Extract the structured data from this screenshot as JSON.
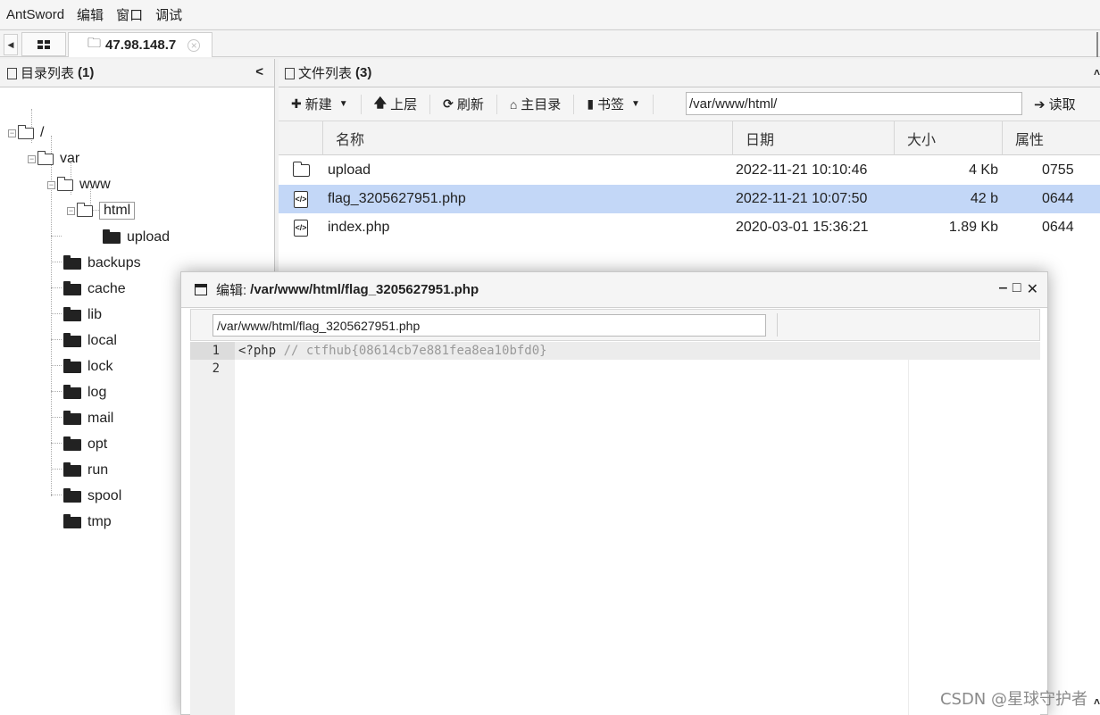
{
  "menubar": {
    "items": [
      "AntSword",
      "编辑",
      "窗口",
      "调试"
    ]
  },
  "tabs": {
    "host_label": "47.98.148.7"
  },
  "dir_panel": {
    "title": "目录列表",
    "count": "(1)",
    "tree": [
      {
        "label": "/"
      },
      {
        "label": "var"
      },
      {
        "label": "www"
      },
      {
        "label": "html"
      },
      {
        "label": "upload"
      },
      {
        "label": "backups"
      },
      {
        "label": "cache"
      },
      {
        "label": "lib"
      },
      {
        "label": "local"
      },
      {
        "label": "lock"
      },
      {
        "label": "log"
      },
      {
        "label": "mail"
      },
      {
        "label": "opt"
      },
      {
        "label": "run"
      },
      {
        "label": "spool"
      },
      {
        "label": "tmp"
      }
    ]
  },
  "file_panel": {
    "title": "文件列表",
    "count": "(3)",
    "toolbar": {
      "new_label": "新建",
      "up_label": "上层",
      "refresh_label": "刷新",
      "home_label": "主目录",
      "bookmark_label": "书签",
      "path_value": "/var/www/html/",
      "read_label": "读取"
    },
    "columns": [
      "名称",
      "日期",
      "大小",
      "属性"
    ],
    "rows": [
      {
        "name": "upload",
        "date": "2022-11-21 10:10:46",
        "size": "4 Kb",
        "perm": "0755",
        "type": "folder"
      },
      {
        "name": "flag_3205627951.php",
        "date": "2022-11-21 10:07:50",
        "size": "42 b",
        "perm": "0644",
        "type": "php"
      },
      {
        "name": "index.php",
        "date": "2020-03-01 15:36:21",
        "size": "1.89 Kb",
        "perm": "0644",
        "type": "php"
      }
    ]
  },
  "editor": {
    "title_prefix": "编辑:",
    "title_path": "/var/www/html/flag_3205627951.php",
    "path_value": "/var/www/html/flag_3205627951.php",
    "lines": [
      {
        "num": "1",
        "code": "<?php",
        "comment": " // ctfhub{08614cb7e881fea8ea10bfd0}"
      },
      {
        "num": "2",
        "code": "",
        "comment": ""
      }
    ]
  },
  "watermark": "CSDN @星球守护者",
  "colors": {
    "selection": "#c3d7f7",
    "panel_header": "#f3f3f3"
  }
}
